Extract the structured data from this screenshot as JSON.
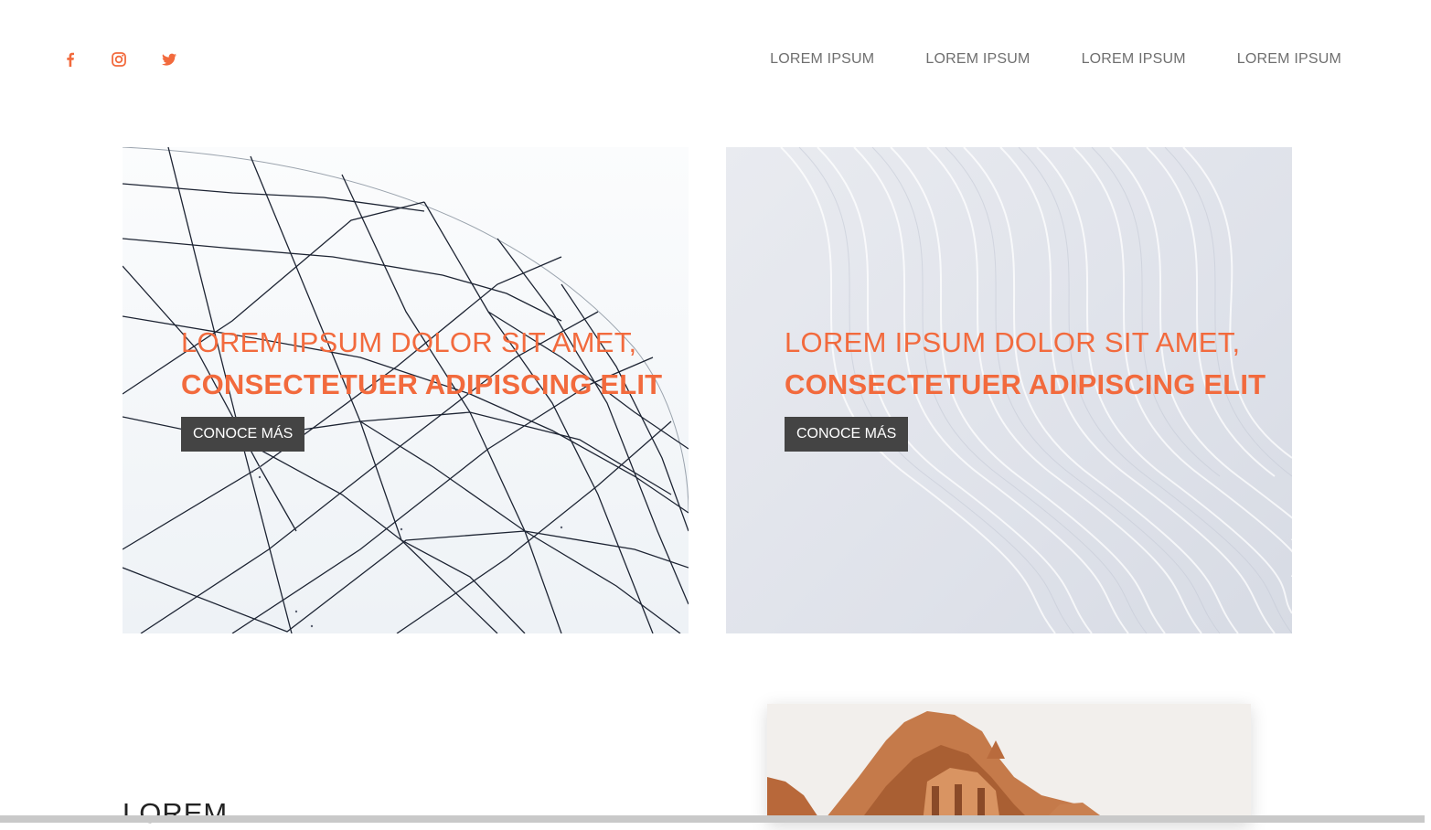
{
  "header": {
    "social": [
      {
        "name": "facebook-icon"
      },
      {
        "name": "instagram-icon"
      },
      {
        "name": "twitter-icon"
      }
    ],
    "nav": [
      "LOREM IPSUM",
      "LOREM IPSUM",
      "LOREM IPSUM",
      "LOREM IPSUM"
    ]
  },
  "heroes": [
    {
      "line1": "LOREM IPSUM DOLOR SIT AMET,",
      "line2": "CONSECTETUER ADIPISCING ELIT",
      "button": "CONOCE MÁS"
    },
    {
      "line1": "LOREM IPSUM DOLOR SIT AMET,",
      "line2": "CONSECTETUER ADIPISCING ELIT",
      "button": "CONOCE MÁS"
    }
  ],
  "section": {
    "title": "LOREM"
  },
  "colors": {
    "accent": "#f26a3d",
    "button_bg": "#444444",
    "nav_text": "#6f6f6f"
  }
}
